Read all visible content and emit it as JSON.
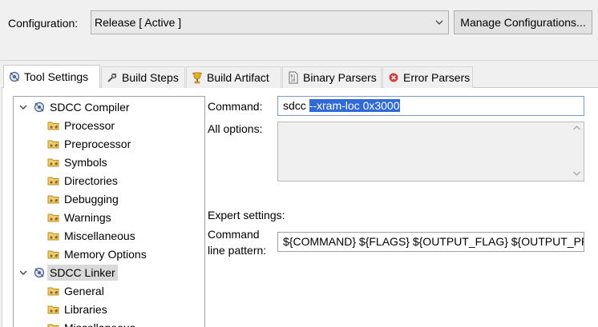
{
  "configuration": {
    "label": "Configuration:",
    "selected": "Release  [ Active ]",
    "manage_button": "Manage Configurations..."
  },
  "tabs": [
    {
      "label": "Tool Settings",
      "icon": "tool-settings-icon",
      "active": true
    },
    {
      "label": "Build Steps",
      "icon": "build-steps-icon",
      "active": false
    },
    {
      "label": "Build Artifact",
      "icon": "build-artifact-icon",
      "active": false
    },
    {
      "label": "Binary Parsers",
      "icon": "binary-parsers-icon",
      "active": false
    },
    {
      "label": "Error Parsers",
      "icon": "error-parsers-icon",
      "active": false
    }
  ],
  "tree": {
    "items": [
      {
        "label": "SDCC Compiler",
        "level": 0,
        "expanded": true,
        "icon": "tool-icon"
      },
      {
        "label": "Processor",
        "level": 1,
        "icon": "folder-options-icon"
      },
      {
        "label": "Preprocessor",
        "level": 1,
        "icon": "folder-options-icon"
      },
      {
        "label": "Symbols",
        "level": 1,
        "icon": "folder-options-icon"
      },
      {
        "label": "Directories",
        "level": 1,
        "icon": "folder-options-icon"
      },
      {
        "label": "Debugging",
        "level": 1,
        "icon": "folder-options-icon"
      },
      {
        "label": "Warnings",
        "level": 1,
        "icon": "folder-options-icon"
      },
      {
        "label": "Miscellaneous",
        "level": 1,
        "icon": "folder-options-icon"
      },
      {
        "label": "Memory Options",
        "level": 1,
        "icon": "folder-options-icon"
      },
      {
        "label": "SDCC Linker",
        "level": 0,
        "expanded": true,
        "selected": true,
        "icon": "tool-icon"
      },
      {
        "label": "General",
        "level": 1,
        "icon": "folder-options-icon"
      },
      {
        "label": "Libraries",
        "level": 1,
        "icon": "folder-options-icon"
      },
      {
        "label": "Miscellaneous",
        "level": 1,
        "icon": "folder-options-icon"
      }
    ]
  },
  "form": {
    "command_label": "Command:",
    "command_prefix": "sdcc ",
    "command_selected": "--xram-loc 0x3000",
    "all_options_label": "All options:",
    "all_options_value": "",
    "expert_settings_label": "Expert settings:",
    "pattern_label_line1": "Command",
    "pattern_label_line2": "line pattern:",
    "pattern_value": "${COMMAND} ${FLAGS} ${OUTPUT_FLAG} ${OUTPUT_PREFIX}${OUTPUT} ${INPUTS}"
  },
  "colors": {
    "selection": "#3069d8",
    "tree_selected": "#d9d9d9",
    "window_bg": "#f0f0f0"
  }
}
